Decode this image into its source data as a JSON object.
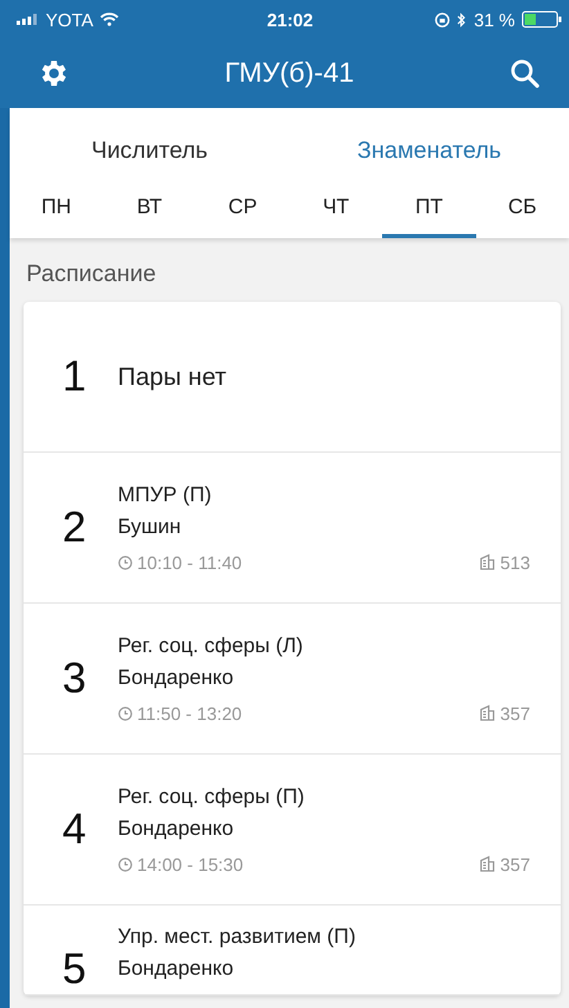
{
  "status_bar": {
    "carrier": "YOTA",
    "time": "21:02",
    "battery_percent": "31 %"
  },
  "app_bar": {
    "title": "ГМУ(б)-41"
  },
  "week_tabs": [
    {
      "label": "Числитель",
      "selected": false
    },
    {
      "label": "Знаменатель",
      "selected": true
    }
  ],
  "day_tabs": [
    {
      "label": "ПН",
      "selected": false
    },
    {
      "label": "ВТ",
      "selected": false
    },
    {
      "label": "СР",
      "selected": false
    },
    {
      "label": "ЧТ",
      "selected": false
    },
    {
      "label": "ПТ",
      "selected": true
    },
    {
      "label": "СБ",
      "selected": false
    }
  ],
  "section_title": "Расписание",
  "lessons": [
    {
      "kind": "empty",
      "number": "1",
      "text": "Пары нет"
    },
    {
      "kind": "lesson",
      "number": "2",
      "subject": "МПУР (П)",
      "teacher": "Бушин",
      "time": "10:10 - 11:40",
      "room": "513"
    },
    {
      "kind": "lesson",
      "number": "3",
      "subject": "Рег. соц. сферы (Л)",
      "teacher": "Бондаренко",
      "time": "11:50 - 13:20",
      "room": "357"
    },
    {
      "kind": "lesson",
      "number": "4",
      "subject": "Рег. соц. сферы (П)",
      "teacher": "Бондаренко",
      "time": "14:00 - 15:30",
      "room": "357"
    },
    {
      "kind": "lesson",
      "number": "5",
      "subject": "Упр. мест. развитием (П)",
      "teacher": "Бондаренко"
    }
  ]
}
